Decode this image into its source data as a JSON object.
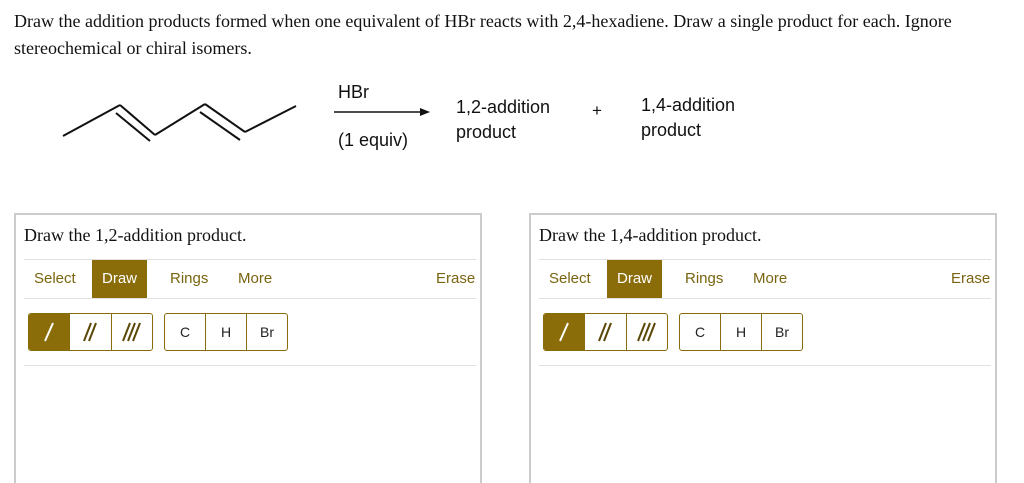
{
  "question": "Draw the addition products formed when one equivalent of HBr reacts with 2,4-hexadiene. Draw a single product for each. Ignore stereochemical or chiral isomers.",
  "scheme": {
    "reagent": "HBr",
    "conditions": "(1 equiv)",
    "product_12_line1": "1,2-addition",
    "product_12_line2": "product",
    "plus": "+",
    "product_14_line1": "1,4-addition",
    "product_14_line2": "product"
  },
  "panels": [
    {
      "title": "Draw the 1,2-addition product.",
      "tools": {
        "select": "Select",
        "draw": "Draw",
        "rings": "Rings",
        "more": "More",
        "erase": "Erase"
      },
      "atoms": [
        "C",
        "H",
        "Br"
      ]
    },
    {
      "title": "Draw the 1,4-addition product.",
      "tools": {
        "select": "Select",
        "draw": "Draw",
        "rings": "Rings",
        "more": "More",
        "erase": "Erase"
      },
      "atoms": [
        "C",
        "H",
        "Br"
      ]
    }
  ],
  "colors": {
    "accent": "#8a6c08",
    "accent_text": "#7a6410",
    "border": "#cccccc"
  }
}
